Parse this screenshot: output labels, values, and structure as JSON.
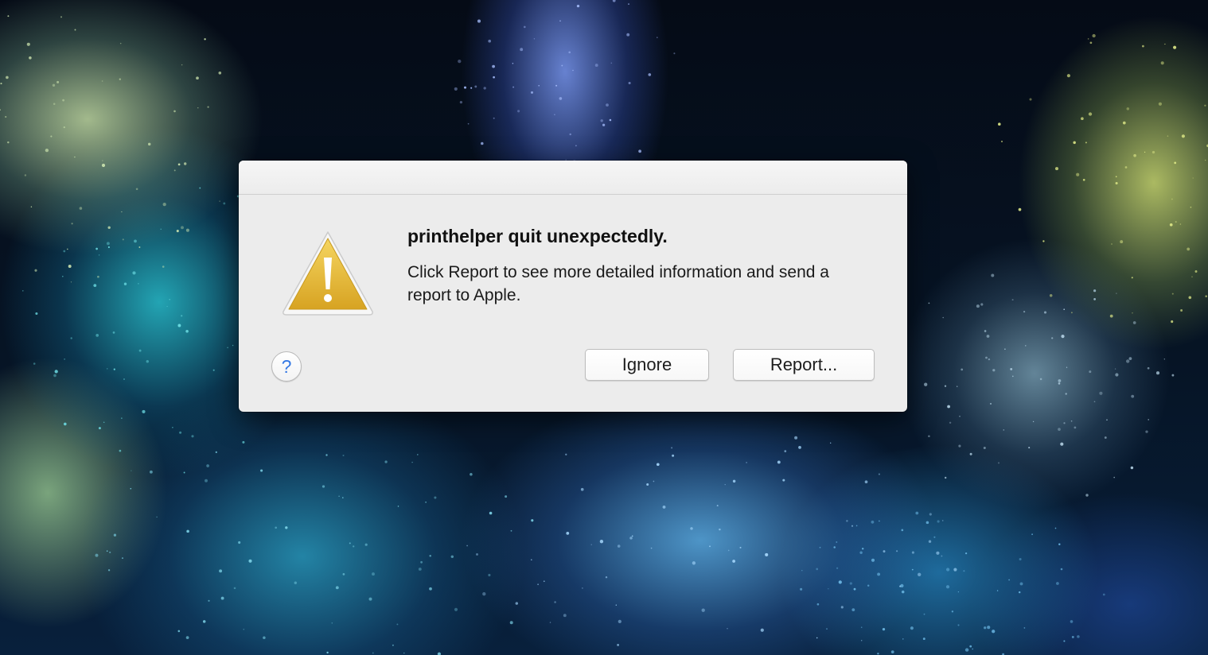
{
  "alert": {
    "title": "printhelper quit unexpectedly.",
    "message": "Click Report to see more detailed information and send a report to Apple.",
    "icon": "warning-icon",
    "help_icon": "help-icon",
    "help_glyph": "?",
    "buttons": {
      "ignore_label": "Ignore",
      "report_label": "Report..."
    }
  },
  "colors": {
    "dialog_background": "#ececec",
    "warning_fill": "#e2b32f",
    "help_glyph": "#3478e4"
  }
}
